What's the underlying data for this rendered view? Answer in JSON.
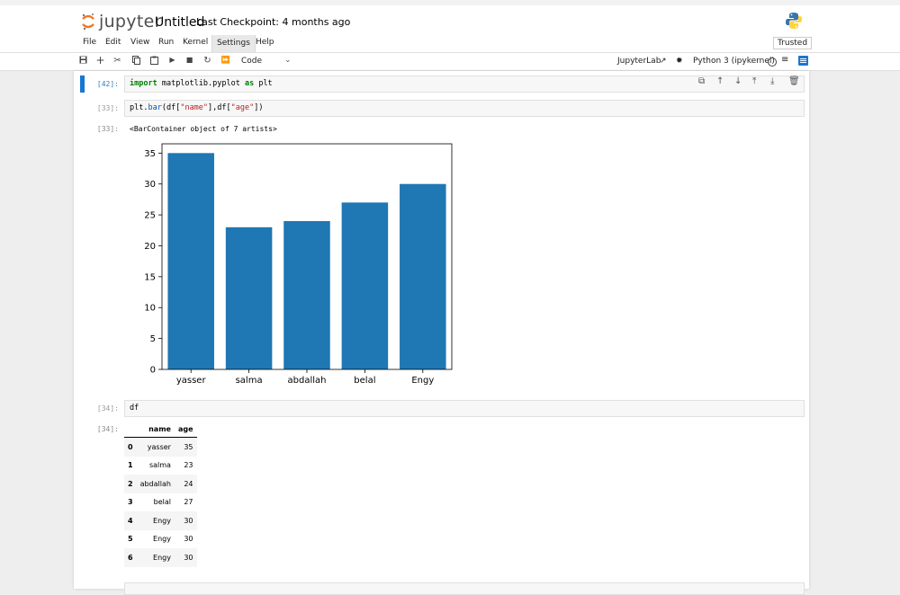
{
  "header": {
    "app_name": "jupyter",
    "notebook_title": "Untitled",
    "checkpoint": "Last Checkpoint: 4 months ago",
    "python_logo_icon": "python-icon"
  },
  "menu": {
    "items": [
      "File",
      "Edit",
      "View",
      "Run",
      "Kernel",
      "Settings",
      "Help"
    ],
    "trusted": "Trusted"
  },
  "toolbar": {
    "cell_type": "Code",
    "jupyterlab_label": "JupyterLab",
    "kernel_name": "Python 3 (ipykernel)"
  },
  "cells": [
    {
      "prompt": "[42]:",
      "code": "import matplotlib.pyplot as plt"
    },
    {
      "prompt": "[33]:",
      "code": "plt.bar(df[\"name\"],df[\"age\"])",
      "out_prompt": "[33]:",
      "output": "<BarContainer object of 7 artists>"
    },
    {
      "prompt": "[34]:",
      "code": "df",
      "out_prompt": "[34]:"
    }
  ],
  "chart_data": {
    "type": "bar",
    "categories": [
      "yasser",
      "salma",
      "abdallah",
      "belal",
      "Engy"
    ],
    "values": [
      35,
      23,
      24,
      27,
      30
    ],
    "yticks": [
      "0",
      "5",
      "10",
      "15",
      "20",
      "25",
      "30",
      "35"
    ],
    "ylim": [
      0,
      36.5
    ],
    "color": "#1f77b4",
    "title": "",
    "xlabel": "",
    "ylabel": ""
  },
  "dataframe": {
    "columns": [
      "name",
      "age"
    ],
    "rows": [
      {
        "index": "0",
        "name": "yasser",
        "age": "35"
      },
      {
        "index": "1",
        "name": "salma",
        "age": "23"
      },
      {
        "index": "2",
        "name": "abdallah",
        "age": "24"
      },
      {
        "index": "3",
        "name": "belal",
        "age": "27"
      },
      {
        "index": "4",
        "name": "Engy",
        "age": "30"
      },
      {
        "index": "5",
        "name": "Engy",
        "age": "30"
      },
      {
        "index": "6",
        "name": "Engy",
        "age": "30"
      }
    ]
  }
}
